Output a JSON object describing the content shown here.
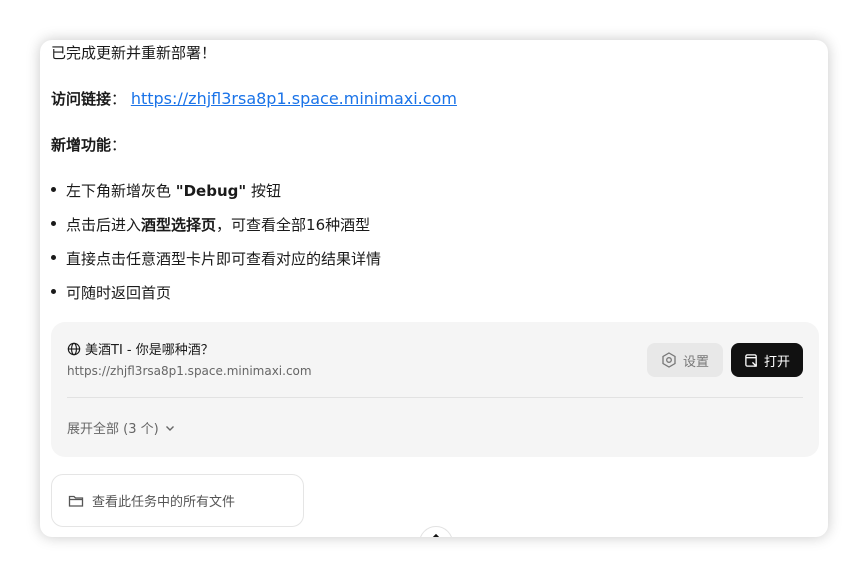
{
  "message": {
    "intro": "已完成更新并重新部署！",
    "access_label": "访问链接",
    "access_colon": "：",
    "access_url": "https://zhjfl3rsa8p1.space.minimaxi.com",
    "features_label": "新增功能",
    "features_colon": "：",
    "bullets": {
      "b1_pre": "左下角新增灰色 ",
      "b1_bold": "\"Debug\"",
      "b1_post": " 按钮",
      "b2_pre": "点击后进入",
      "b2_bold": "酒型选择页",
      "b2_post": "，可查看全部16种酒型",
      "b3": "直接点击任意酒型卡片即可查看对应的结果详情",
      "b4": "可随时返回首页"
    }
  },
  "card": {
    "title": "美酒TI - 你是哪种酒？",
    "url": "https://zhjfl3rsa8p1.space.minimaxi.com",
    "settings_label": "设置",
    "open_label": "打开",
    "expand_label": "展开全部 (3 个)"
  },
  "files": {
    "label": "查看此任务中的所有文件"
  },
  "icons": {
    "globe": "globe-icon",
    "settings": "gear-icon",
    "open": "open-external-icon",
    "expand": "chevron-down-icon",
    "folder": "folder-icon",
    "scroll": "arrow-up-icon"
  }
}
